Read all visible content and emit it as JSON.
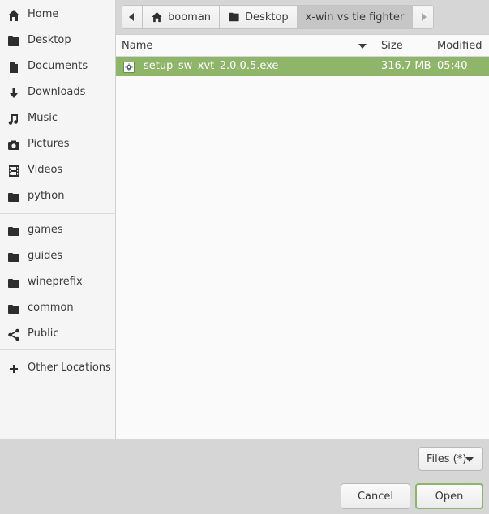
{
  "sidebar": {
    "items": [
      {
        "label": "Home",
        "icon": "home-icon"
      },
      {
        "label": "Desktop",
        "icon": "folder-icon"
      },
      {
        "label": "Documents",
        "icon": "document-icon"
      },
      {
        "label": "Downloads",
        "icon": "download-icon"
      },
      {
        "label": "Music",
        "icon": "music-icon"
      },
      {
        "label": "Pictures",
        "icon": "camera-icon"
      },
      {
        "label": "Videos",
        "icon": "film-icon"
      },
      {
        "label": "python",
        "icon": "folder-icon"
      }
    ],
    "bookmarks": [
      {
        "label": "games",
        "icon": "folder-icon"
      },
      {
        "label": "guides",
        "icon": "folder-icon"
      },
      {
        "label": "wineprefix",
        "icon": "folder-icon"
      },
      {
        "label": "common",
        "icon": "folder-icon"
      },
      {
        "label": "Public",
        "icon": "share-icon"
      }
    ],
    "other_locations": "Other Locations"
  },
  "pathbar": {
    "crumbs": [
      "booman",
      "Desktop",
      "x-win vs tie fighter"
    ]
  },
  "filelist": {
    "columns": {
      "name": "Name",
      "size": "Size",
      "modified": "Modified"
    },
    "rows": [
      {
        "name": "setup_sw_xvt_2.0.0.5.exe",
        "size": "316.7 MB",
        "modified": "05:40",
        "icon": "executable-icon"
      }
    ]
  },
  "filter": {
    "label": "Files (*)"
  },
  "buttons": {
    "cancel": "Cancel",
    "open": "Open"
  },
  "colors": {
    "selection": "#8fb56a",
    "sidebar_bg": "#f5f5f5",
    "footer_bg": "#d6d6d6"
  }
}
